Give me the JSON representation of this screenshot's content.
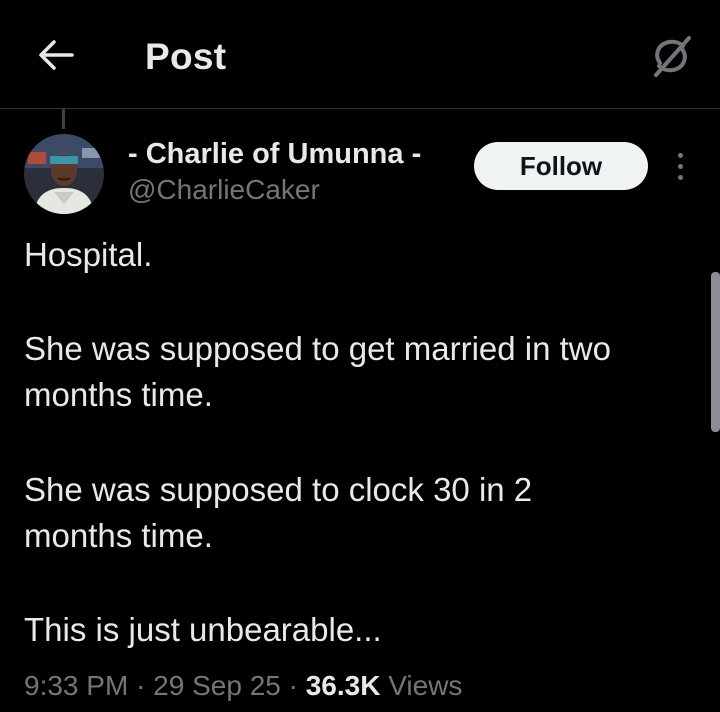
{
  "header": {
    "title": "Post",
    "back_icon": "arrow-left-icon",
    "grok_icon": "grok-icon"
  },
  "author": {
    "name": "- Charlie of Umunna -",
    "handle": "@CharlieCaker",
    "follow_label": "Follow"
  },
  "tweet": {
    "lines": [
      "Hospital.",
      "She was supposed to get married in two",
      "months time.",
      "She was supposed to clock 30 in 2",
      "months time.",
      "This is just unbearable..."
    ]
  },
  "meta": {
    "time": "9:33 PM",
    "separator": " · ",
    "date": "29 Sep 25",
    "views_count": "36.3K",
    "views_label": " Views"
  },
  "colors": {
    "background": "#000000",
    "text": "#e7e9ea",
    "secondary": "#71767b",
    "follow_bg": "#eff3f4"
  }
}
